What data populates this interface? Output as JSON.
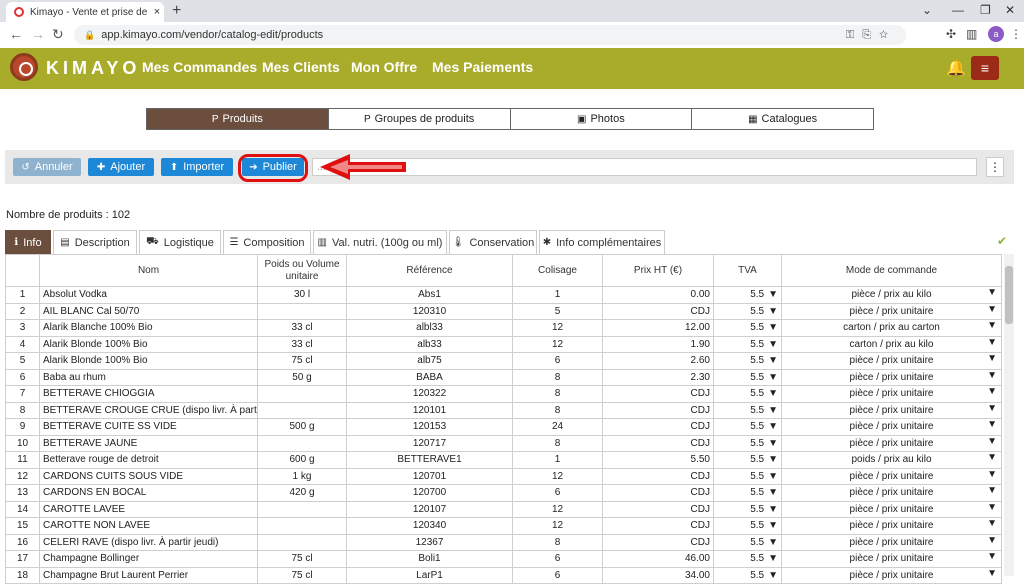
{
  "browser": {
    "tab_title": "Kimayo - Vente et prise de comm",
    "tab_close": "×",
    "new_tab": "+",
    "url": "app.kimayo.com/vendor/catalog-edit/products",
    "avatar_letter": "a"
  },
  "app": {
    "logo_text": "KIMAYO",
    "nav": [
      "Mes Commandes",
      "Mes Clients",
      "Mon Offre",
      "Mes Paiements"
    ],
    "menu_glyph": "≡"
  },
  "segments": [
    {
      "label": "Produits",
      "icon": "P",
      "active": true
    },
    {
      "label": "Groupes de produits",
      "icon": "P",
      "active": false
    },
    {
      "label": "Photos",
      "icon": "▣",
      "active": false
    },
    {
      "label": "Catalogues",
      "icon": "▦",
      "active": false
    }
  ],
  "toolbar": {
    "annuler": "Annuler",
    "ajouter": "Ajouter",
    "importer": "Importer",
    "publier": "Publier",
    "search_text": "...",
    "kebab": "⋮"
  },
  "count_label": "Nombre de produits : 102",
  "detail_tabs": [
    {
      "label": "Info",
      "icon": "ℹ",
      "active": true
    },
    {
      "label": "Description",
      "icon": "▤",
      "active": false
    },
    {
      "label": "Logistique",
      "icon": "⛟",
      "active": false
    },
    {
      "label": "Composition",
      "icon": "☰",
      "active": false
    },
    {
      "label": "Val. nutri. (100g ou ml)",
      "icon": "▥",
      "active": false
    },
    {
      "label": "Conservation",
      "icon": "🌡",
      "active": false
    },
    {
      "label": "Info complémentaires",
      "icon": "✱",
      "active": false
    }
  ],
  "check_glyph": "✔",
  "dropdown_glyph": "▼",
  "table": {
    "headers": [
      "",
      "Nom",
      "Poids ou Volume unitaire",
      "Référence",
      "Colisage",
      "Prix HT (€)",
      "TVA",
      "Mode de commande"
    ],
    "rows": [
      [
        "1",
        "Absolut Vodka",
        "30 l",
        "Abs1",
        "1",
        "0.00",
        "5.5",
        "pièce / prix au kilo"
      ],
      [
        "2",
        "AIL BLANC Cal 50/70",
        "",
        "120310",
        "5",
        "CDJ",
        "5.5",
        "pièce / prix unitaire"
      ],
      [
        "3",
        "Alarik Blanche 100% Bio",
        "33 cl",
        "albl33",
        "12",
        "12.00",
        "5.5",
        "carton / prix au carton"
      ],
      [
        "4",
        "Alarik Blonde 100% Bio",
        "33 cl",
        "alb33",
        "12",
        "1.90",
        "5.5",
        "carton / prix au kilo"
      ],
      [
        "5",
        "Alarik Blonde 100% Bio",
        "75 cl",
        "alb75",
        "6",
        "2.60",
        "5.5",
        "pièce / prix unitaire"
      ],
      [
        "6",
        "Baba au rhum",
        "50 g",
        "BABA",
        "8",
        "2.30",
        "5.5",
        "pièce / prix unitaire"
      ],
      [
        "7",
        "BETTERAVE CHIOGGIA",
        "",
        "120322",
        "8",
        "CDJ",
        "5.5",
        "pièce / prix unitaire"
      ],
      [
        "8",
        "BETTERAVE CROUGE CRUE (dispo livr. À partir j...",
        "",
        "120101",
        "8",
        "CDJ",
        "5.5",
        "pièce / prix unitaire"
      ],
      [
        "9",
        "BETTERAVE CUITE SS VIDE",
        "500 g",
        "120153",
        "24",
        "CDJ",
        "5.5",
        "pièce / prix unitaire"
      ],
      [
        "10",
        "BETTERAVE JAUNE",
        "",
        "120717",
        "8",
        "CDJ",
        "5.5",
        "pièce / prix unitaire"
      ],
      [
        "11",
        "Betterave rouge de detroit",
        "600 g",
        "BETTERAVE1",
        "1",
        "5.50",
        "5.5",
        "poids / prix au kilo"
      ],
      [
        "12",
        "CARDONS CUITS SOUS VIDE",
        "1 kg",
        "120701",
        "12",
        "CDJ",
        "5.5",
        "pièce / prix unitaire"
      ],
      [
        "13",
        "CARDONS EN BOCAL",
        "420 g",
        "120700",
        "6",
        "CDJ",
        "5.5",
        "pièce / prix unitaire"
      ],
      [
        "14",
        "CAROTTE LAVEE",
        "",
        "120107",
        "12",
        "CDJ",
        "5.5",
        "pièce / prix unitaire"
      ],
      [
        "15",
        "CAROTTE NON LAVEE",
        "",
        "120340",
        "12",
        "CDJ",
        "5.5",
        "pièce / prix unitaire"
      ],
      [
        "16",
        "CELERI RAVE (dispo livr. À partir jeudi)",
        "",
        "12367",
        "8",
        "CDJ",
        "5.5",
        "pièce / prix unitaire"
      ],
      [
        "17",
        "Champagne Bollinger",
        "75 cl",
        "Boli1",
        "6",
        "46.00",
        "5.5",
        "pièce / prix unitaire"
      ],
      [
        "18",
        "Champagne Brut Laurent Perrier",
        "75 cl",
        "LarP1",
        "6",
        "34.00",
        "5.5",
        "pièce / prix unitaire"
      ]
    ]
  },
  "colors": {
    "appbar": "#a9ac2a",
    "brown_active": "#6b4e3d",
    "primary_button": "#1e88d8",
    "disabled_button": "#8fb3cf",
    "highlight_red": "#e01010"
  }
}
